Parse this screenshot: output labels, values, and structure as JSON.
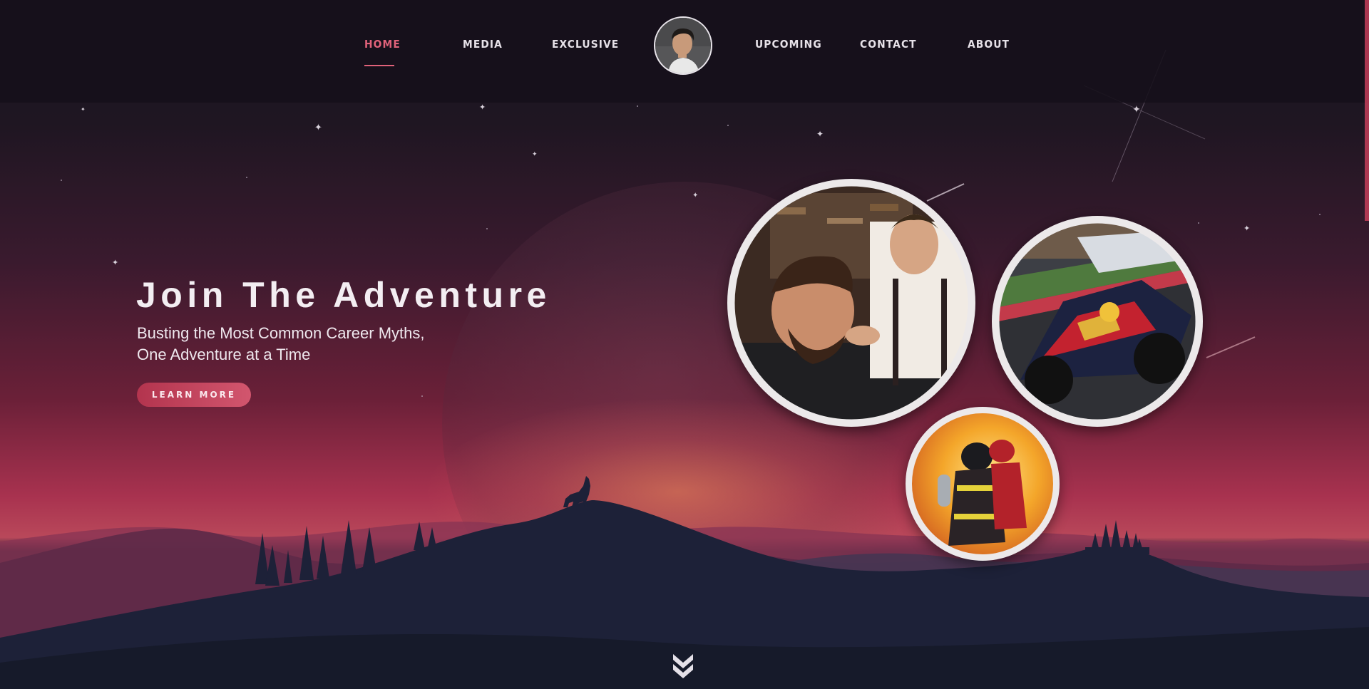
{
  "nav": {
    "items": [
      {
        "label": "HOME",
        "active": true
      },
      {
        "label": "MEDIA"
      },
      {
        "label": "EXCLUSIVE"
      },
      {
        "label": "UPCOMING"
      },
      {
        "label": "CONTACT"
      },
      {
        "label": "ABOUT"
      }
    ],
    "avatar_icon": "profile-avatar",
    "accent_color": "#e0627a"
  },
  "hero": {
    "title": "Join The Adventure",
    "subtitle_line1": "Busting the Most Common Career Myths,",
    "subtitle_line2": "One Adventure at a Time",
    "cta_label": "LEARN MORE"
  },
  "gallery": {
    "photos": [
      "barber-photo",
      "race-car-photo",
      "firefighter-photo"
    ]
  },
  "scroll_icon": "double-chevron-down-icon"
}
